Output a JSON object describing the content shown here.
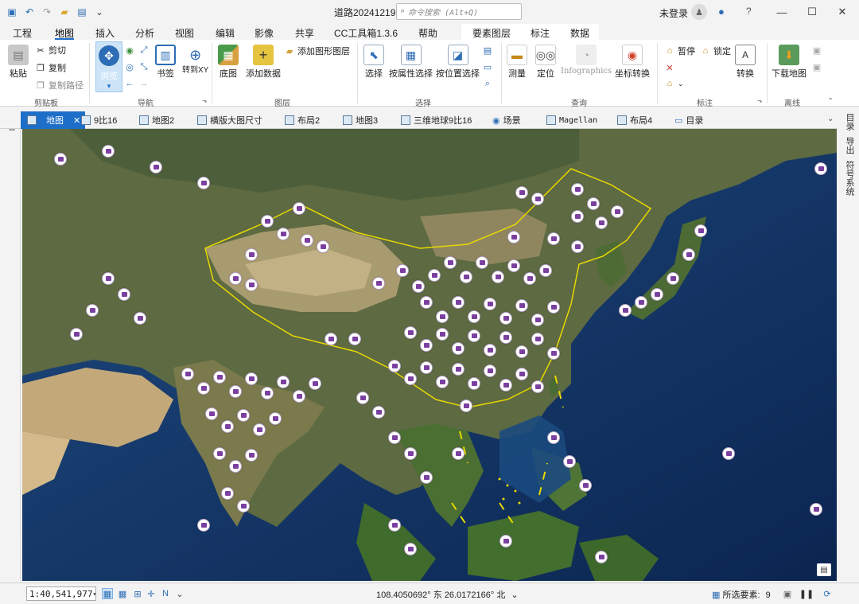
{
  "window": {
    "title": "道路20241219",
    "search_placeholder": "命令搜索 (Alt+Q)",
    "signin": "未登录",
    "minimize": "—",
    "maximize": "☐",
    "close": "✕",
    "help": "?"
  },
  "menu": {
    "tabs": [
      "工程",
      "地图",
      "插入",
      "分析",
      "视图",
      "编辑",
      "影像",
      "共享",
      "CC工具箱1.3.6",
      "帮助",
      "要素图层",
      "标注",
      "数据"
    ],
    "active": "地图"
  },
  "ribbon": {
    "clipboard": {
      "paste": "粘贴",
      "cut": "剪切",
      "copy": "复制",
      "copy_path": "复制路径",
      "group": "剪贴板"
    },
    "navigate": {
      "browse": "浏览",
      "bookmarks": "书签",
      "goto_xy": "转到XY",
      "goto_xy_2": "XY",
      "group": "导航"
    },
    "layer": {
      "basemap": "底图",
      "add_data": "添加数据",
      "add_graphics": "添加图形图层",
      "group": "图层"
    },
    "selection": {
      "select": "选择",
      "by_attr": "按属性选择",
      "by_loc": "按位置选择",
      "group": "选择"
    },
    "inquiry": {
      "measure": "测量",
      "locate": "定位",
      "infographics": "Infographics",
      "convert_coord": "坐标转换",
      "group": "查询"
    },
    "labeling": {
      "pause": "暂停",
      "lock": "锁定",
      "convert": "转换",
      "group": "标注"
    },
    "offline": {
      "download_map": "下载地图",
      "group": "离线"
    }
  },
  "doc_tabs": [
    "地图",
    "9比16",
    "地图2",
    "横版大图尺寸",
    "布局2",
    "地图3",
    "三维地球9比16",
    "场景",
    "Magellan",
    "布局4",
    "目录"
  ],
  "side": {
    "left": "内容",
    "right": [
      "目录",
      "导出",
      "符号系统"
    ]
  },
  "status": {
    "scale": "1:40,541,977",
    "coords": "108.4050692° 东 26.0172166° 北",
    "selected_label": "所选要素:",
    "selected_count": "9"
  },
  "colors": {
    "accent": "#1d6ec8",
    "poi_symbol": "#7b3fa0",
    "boundary": "#e8d800"
  },
  "icons": {
    "window": [
      "save-icon",
      "undo-icon",
      "redo-icon",
      "open-icon",
      "layout-icon",
      "customize-icon",
      "search-icon",
      "notification-icon",
      "user-icon"
    ],
    "status": [
      "table-icon",
      "grid-icon",
      "snapping-icon",
      "north-arrow-icon",
      "pause-icon",
      "refresh-icon"
    ]
  }
}
